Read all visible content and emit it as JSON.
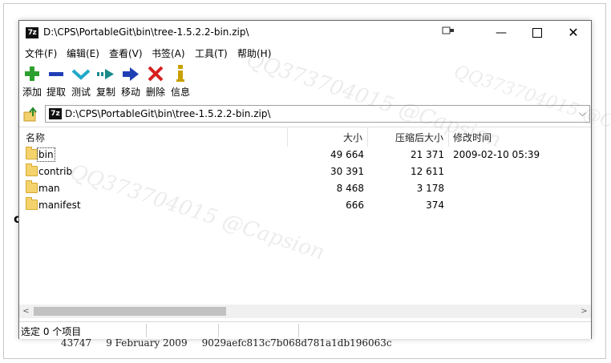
{
  "window": {
    "title": "D:\\CPS\\PortableGit\\bin\\tree-1.5.2.2-bin.zip\\",
    "app_icon_text": "7z",
    "controls": {
      "minimize": "—",
      "close": "✕"
    }
  },
  "menu": [
    {
      "label": "文件(F)"
    },
    {
      "label": "编辑(E)"
    },
    {
      "label": "查看(V)"
    },
    {
      "label": "书签(A)"
    },
    {
      "label": "工具(T)"
    },
    {
      "label": "帮助(H)"
    }
  ],
  "toolbar": [
    {
      "label": "添加",
      "icon": "plus-icon",
      "color": "#2ca02c"
    },
    {
      "label": "提取",
      "icon": "minus-icon",
      "color": "#1f3fb4"
    },
    {
      "label": "测试",
      "icon": "check-icon",
      "color": "#20a8c8"
    },
    {
      "label": "复制",
      "icon": "copy-arrow-icon",
      "color": "#1a8a8a"
    },
    {
      "label": "移动",
      "icon": "move-arrow-icon",
      "color": "#1f3fb4"
    },
    {
      "label": "删除",
      "icon": "delete-x-icon",
      "color": "#d62020"
    },
    {
      "label": "信息",
      "icon": "info-icon",
      "color": "#c8a000"
    }
  ],
  "address": {
    "icon_text": "7z",
    "path": "D:\\CPS\\PortableGit\\bin\\tree-1.5.2.2-bin.zip\\"
  },
  "columns": {
    "name": "名称",
    "size": "大小",
    "packed": "压缩后大小",
    "modified": "修改时间"
  },
  "files": [
    {
      "name": "bin",
      "size": "49 664",
      "packed": "21 371",
      "modified": "2009-02-10 05:39"
    },
    {
      "name": "contrib",
      "size": "30 391",
      "packed": "12 611",
      "modified": ""
    },
    {
      "name": "man",
      "size": "8 468",
      "packed": "3 178",
      "modified": ""
    },
    {
      "name": "manifest",
      "size": "666",
      "packed": "374",
      "modified": ""
    }
  ],
  "status": {
    "text": "选定 0 个项目"
  },
  "background": {
    "fragment": "c",
    "line": [
      "43747",
      "9 February 2009",
      "9029aefc813c7b068d781a1db196063c"
    ]
  },
  "watermark": "QQ373704015 @Capsion"
}
